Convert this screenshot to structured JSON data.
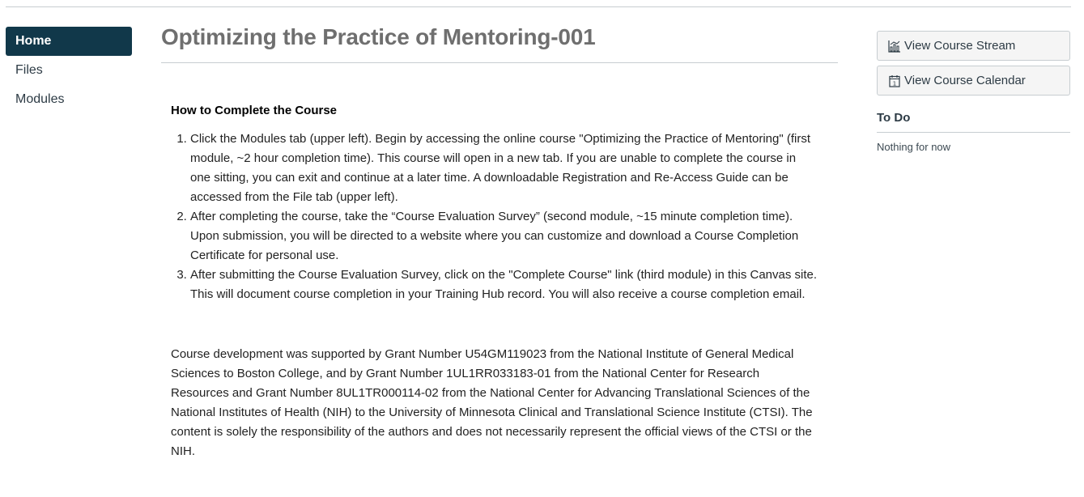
{
  "nav": {
    "items": [
      {
        "label": "Home",
        "active": true
      },
      {
        "label": "Files",
        "active": false
      },
      {
        "label": "Modules",
        "active": false
      }
    ]
  },
  "main": {
    "title": "Optimizing the Practice of Mentoring-001",
    "heading": "How to Complete the Course",
    "steps": [
      "Click the Modules tab (upper left).  Begin by accessing the online course \"Optimizing the Practice of Mentoring\" (first module, ~2 hour completion time). This course will open in a new tab. If you are unable to complete the course in one sitting, you can exit and continue at a later time.  A downloadable Registration and Re-Access Guide can be accessed from the File tab (upper left).",
      "After completing the course, take the “Course Evaluation Survey”  (second module, ~15 minute completion time). Upon submission, you will be directed to a website where you can customize and download a Course Completion Certificate for personal use.",
      "After submitting the Course Evaluation Survey, click on the \"Complete Course\" link (third module) in this Canvas site. This will document course completion in your Training Hub record. You will also receive a course completion email."
    ],
    "grant_text": "Course development was supported by Grant Number U54GM119023 from the National Institute of General Medical Sciences to Boston College, and by Grant Number 1UL1RR033183-01 from the National Center for Research Resources and Grant Number 8UL1TR000114-02 from the National Center for Advancing Translational Sciences of the National Institutes of Health (NIH) to the University of Minnesota Clinical and Translational Science Institute (CTSI).  The content is solely the responsibility of the authors and does not necessarily represent the official views of the CTSI or the NIH."
  },
  "sidebar": {
    "stream_label": "View Course Stream",
    "stream_icon": "stream-chart-icon",
    "calendar_label": "View Course Calendar",
    "calendar_icon": "calendar-icon",
    "todo_heading": "To Do",
    "todo_empty": "Nothing for now"
  },
  "colors": {
    "nav_active_bg": "#11384a",
    "title": "#6f6f6f",
    "text": "#2d3b45"
  }
}
